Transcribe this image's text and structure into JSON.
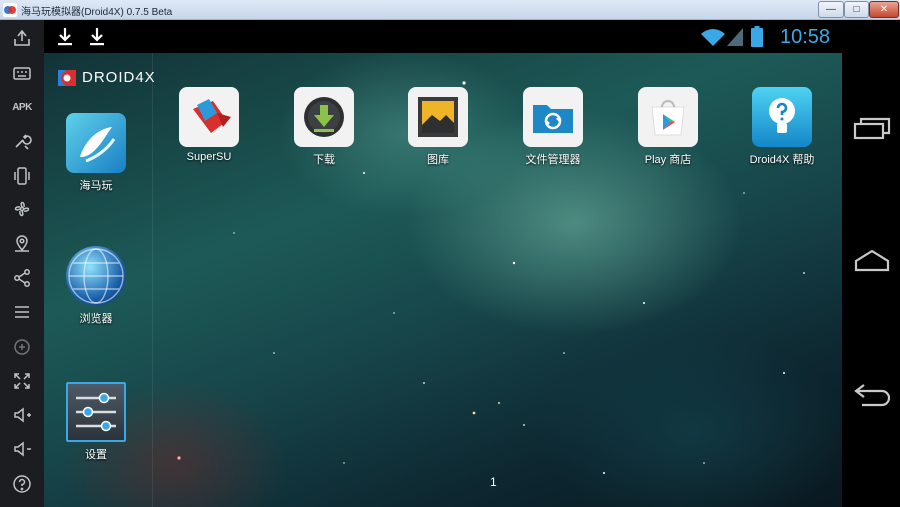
{
  "window": {
    "title": "海马玩模拟器(Droid4X) 0.7.5 Beta",
    "min_label": "—",
    "max_label": "□",
    "close_label": "✕"
  },
  "toolbar": {
    "items": [
      {
        "name": "share-icon"
      },
      {
        "name": "keyboard-icon"
      },
      {
        "name": "apk-install-icon",
        "text": "APK"
      },
      {
        "name": "wrench-icon"
      },
      {
        "name": "shake-icon"
      },
      {
        "name": "location-icon"
      },
      {
        "name": "share-network-icon"
      },
      {
        "name": "menu-icon"
      },
      {
        "name": "chat-icon"
      },
      {
        "name": "fullscreen-icon"
      },
      {
        "name": "volume-up-icon"
      },
      {
        "name": "volume-down-icon"
      },
      {
        "name": "help-icon"
      }
    ]
  },
  "statusbar": {
    "time": "10:58",
    "notifications": [
      "download-icon",
      "download-icon"
    ]
  },
  "launcher": {
    "logo_text": "DROID4X",
    "dock_apps": [
      {
        "label": "海马玩"
      },
      {
        "label": "浏览器"
      },
      {
        "label": "设置"
      }
    ],
    "home_apps": [
      {
        "label": "SuperSU"
      },
      {
        "label": "下载"
      },
      {
        "label": "图库"
      },
      {
        "label": "文件管理器"
      },
      {
        "label": "Play 商店"
      },
      {
        "label": "Droid4X 帮助"
      }
    ],
    "page_number": "1"
  },
  "colors": {
    "clock": "#3aa8e6",
    "toolbar_bg": "#1b1d20"
  }
}
